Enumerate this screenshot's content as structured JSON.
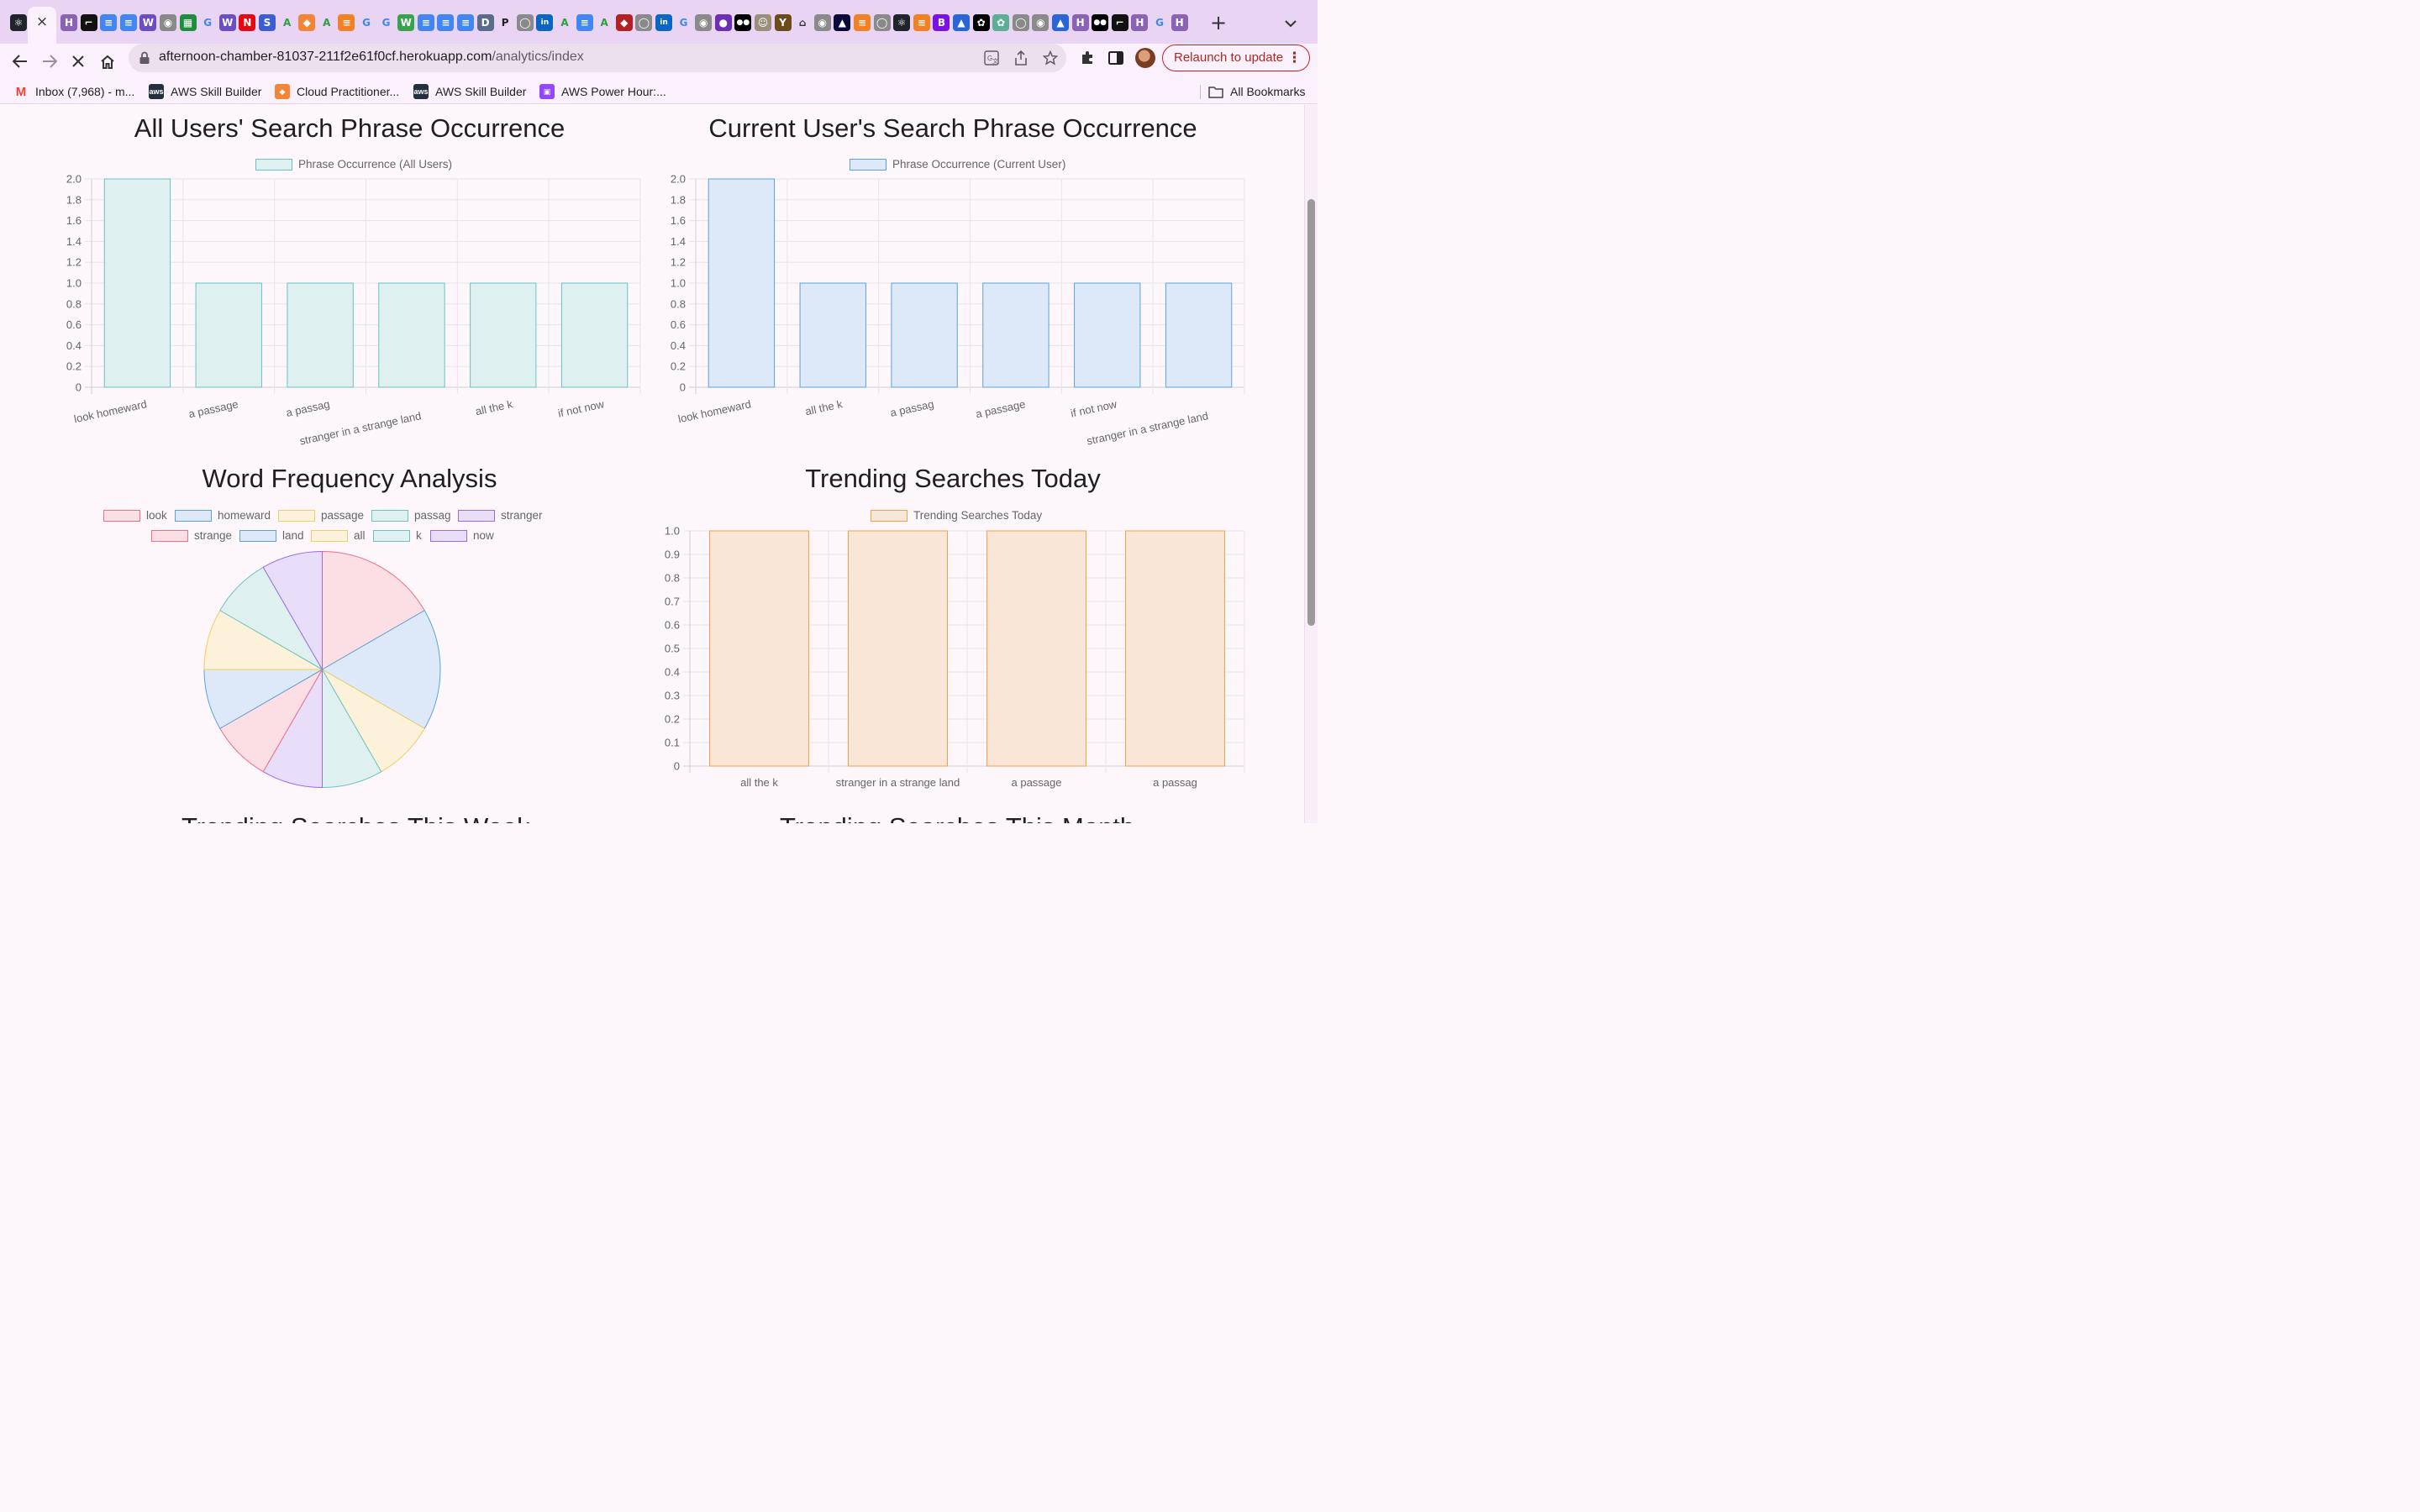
{
  "browser": {
    "tab_close_glyph": "×",
    "new_tab_glyph": "+",
    "tabs": [
      {
        "icon": "react-icon",
        "color": "#20232a",
        "glyph": "⚛"
      },
      {
        "icon": "active-tab-close",
        "color": "",
        "glyph": ""
      },
      {
        "icon": "heroku-icon",
        "color": "#8b63b5",
        "glyph": "H"
      },
      {
        "icon": "linear-icon",
        "color": "#111111",
        "glyph": "⌐"
      },
      {
        "icon": "docs-icon",
        "color": "#4285f4",
        "glyph": "≡"
      },
      {
        "icon": "docs-icon",
        "color": "#4285f4",
        "glyph": "≡"
      },
      {
        "icon": "workers-icon",
        "color": "#6b4ec6",
        "glyph": "W"
      },
      {
        "icon": "globe-icon",
        "color": "#8a8a8a",
        "glyph": "◉"
      },
      {
        "icon": "sheet-icon",
        "color": "#1e8e3e",
        "glyph": "▦"
      },
      {
        "icon": "google-icon",
        "color": "#ffffff",
        "glyph": "G"
      },
      {
        "icon": "workers-icon",
        "color": "#6b4ec6",
        "glyph": "W"
      },
      {
        "icon": "netflix-icon",
        "color": "#e50914",
        "glyph": "N"
      },
      {
        "icon": "sql-icon",
        "color": "#3b5fd0",
        "glyph": "S"
      },
      {
        "icon": "aws-green-icon",
        "color": "#ffffff",
        "glyph": "A"
      },
      {
        "icon": "cube-icon",
        "color": "#f58536",
        "glyph": "◆"
      },
      {
        "icon": "aws-green-icon",
        "color": "#ffffff",
        "glyph": "A"
      },
      {
        "icon": "stackoverflow-icon",
        "color": "#f48024",
        "glyph": "≡"
      },
      {
        "icon": "google-icon",
        "color": "#ffffff",
        "glyph": "G"
      },
      {
        "icon": "google-icon",
        "color": "#ffffff",
        "glyph": "G"
      },
      {
        "icon": "w-icon",
        "color": "#37a34a",
        "glyph": "W"
      },
      {
        "icon": "docs-icon",
        "color": "#4285f4",
        "glyph": "≡"
      },
      {
        "icon": "docs-icon",
        "color": "#4285f4",
        "glyph": "≡"
      },
      {
        "icon": "docs-icon",
        "color": "#4285f4",
        "glyph": "≡"
      },
      {
        "icon": "dev-icon",
        "color": "#5a6b8c",
        "glyph": "D"
      },
      {
        "icon": "p-icon",
        "color": "#ffffff",
        "glyph": "P"
      },
      {
        "icon": "github-icon",
        "color": "#8a8a8a",
        "glyph": "◯"
      },
      {
        "icon": "linkedin-icon",
        "color": "#0a66c2",
        "glyph": "in"
      },
      {
        "icon": "aws-green-icon",
        "color": "#ffffff",
        "glyph": "A"
      },
      {
        "icon": "docs-icon",
        "color": "#4285f4",
        "glyph": "≡"
      },
      {
        "icon": "aws-green-icon",
        "color": "#ffffff",
        "glyph": "A"
      },
      {
        "icon": "ruby-icon",
        "color": "#b52020",
        "glyph": "◆"
      },
      {
        "icon": "github-icon",
        "color": "#8a8a8a",
        "glyph": "◯"
      },
      {
        "icon": "linkedin-icon",
        "color": "#0a66c2",
        "glyph": "in"
      },
      {
        "icon": "google-icon",
        "color": "#ffffff",
        "glyph": "G"
      },
      {
        "icon": "globe-icon",
        "color": "#8a8a8a",
        "glyph": "◉"
      },
      {
        "icon": "blob-icon",
        "color": "#6a2fb6",
        "glyph": "●"
      },
      {
        "icon": "medium-icon",
        "color": "#000000",
        "glyph": "●●"
      },
      {
        "icon": "face-icon",
        "color": "#9b8e7a",
        "glyph": "☺"
      },
      {
        "icon": "ycombinator-icon",
        "color": "#6b4a1c",
        "glyph": "Y"
      },
      {
        "icon": "home-icon",
        "color": "#ffffff",
        "glyph": "⌂"
      },
      {
        "icon": "globe-icon",
        "color": "#8a8a8a",
        "glyph": "◉"
      },
      {
        "icon": "vercel-icon",
        "color": "#0b0b3a",
        "glyph": "▲"
      },
      {
        "icon": "stackoverflow-icon",
        "color": "#f48024",
        "glyph": "≡"
      },
      {
        "icon": "github-icon",
        "color": "#8a8a8a",
        "glyph": "◯"
      },
      {
        "icon": "react-icon",
        "color": "#20232a",
        "glyph": "⚛"
      },
      {
        "icon": "stackoverflow-icon",
        "color": "#f48024",
        "glyph": "≡"
      },
      {
        "icon": "bootstrap-icon",
        "color": "#7a12e6",
        "glyph": "B"
      },
      {
        "icon": "atlassian-icon",
        "color": "#2965d6",
        "glyph": "▲"
      },
      {
        "icon": "openai-icon",
        "color": "#000000",
        "glyph": "✿"
      },
      {
        "icon": "openai-icon",
        "color": "#5cae95",
        "glyph": "✿"
      },
      {
        "icon": "github-icon",
        "color": "#8a8a8a",
        "glyph": "◯"
      },
      {
        "icon": "globe-icon",
        "color": "#8a8a8a",
        "glyph": "◉"
      },
      {
        "icon": "atlassian-icon",
        "color": "#2965d6",
        "glyph": "▲"
      },
      {
        "icon": "heroku-icon",
        "color": "#8b63b5",
        "glyph": "H"
      },
      {
        "icon": "medium-icon",
        "color": "#000000",
        "glyph": "●●"
      },
      {
        "icon": "linear-icon",
        "color": "#111111",
        "glyph": "⌐"
      },
      {
        "icon": "heroku-icon",
        "color": "#8b63b5",
        "glyph": "H"
      },
      {
        "icon": "google-icon",
        "color": "#ffffff",
        "glyph": "G"
      },
      {
        "icon": "heroku-icon",
        "color": "#8b63b5",
        "glyph": "H"
      }
    ],
    "url_host": "afternoon-chamber-81037-211f2e61f0cf.herokuapp.com",
    "url_path": "/analytics/index",
    "relaunch_label": "Relaunch to update",
    "relaunch_menu": "⋮",
    "bookmarks": [
      {
        "label": "Inbox (7,968) - m...",
        "icon": "gmail-icon",
        "color": "#ffffff",
        "glyph": "M"
      },
      {
        "label": "AWS Skill Builder",
        "icon": "aws-icon",
        "color": "#232f3e",
        "glyph": "aws"
      },
      {
        "label": "Cloud Practitioner...",
        "icon": "cube-icon",
        "color": "#f58536",
        "glyph": "◆"
      },
      {
        "label": "AWS Skill Builder",
        "icon": "aws-icon",
        "color": "#232f3e",
        "glyph": "aws"
      },
      {
        "label": "AWS Power Hour:...",
        "icon": "twitch-icon",
        "color": "#9146ff",
        "glyph": "▣"
      }
    ],
    "all_bookmarks_label": "All Bookmarks"
  },
  "charts": {
    "all_users": {
      "title": "All Users' Search Phrase Occurrence",
      "legend": "Phrase Occurrence (All Users)",
      "fill": "#dff0f0",
      "stroke": "#6cc2c2"
    },
    "current_user": {
      "title": "Current User's Search Phrase Occurrence",
      "legend": "Phrase Occurrence (Current User)",
      "fill": "#dde9f8",
      "stroke": "#5ea2dc"
    },
    "word_freq": {
      "title": "Word Frequency Analysis"
    },
    "trending_today": {
      "title": "Trending Searches Today",
      "legend": "Trending Searches Today",
      "fill": "#fae6d6",
      "stroke": "#f0a04b"
    }
  },
  "peek": {
    "left": "Trending Searches This Week",
    "right": "Trending Searches This Month"
  },
  "chart_data": [
    {
      "type": "bar",
      "title": "All Users' Search Phrase Occurrence",
      "categories": [
        "look homeward",
        "a passage",
        "a passag",
        "stranger in a strange land",
        "all the k",
        "if not now"
      ],
      "series": [
        {
          "name": "Phrase Occurrence (All Users)",
          "values": [
            2,
            1,
            1,
            1,
            1,
            1
          ]
        }
      ],
      "ylim": [
        0,
        2.0
      ],
      "yticks": [
        "0",
        "0.2",
        "0.4",
        "0.6",
        "0.8",
        "1.0",
        "1.2",
        "1.4",
        "1.6",
        "1.8",
        "2.0"
      ],
      "legend": "top",
      "grid": true
    },
    {
      "type": "bar",
      "title": "Current User's Search Phrase Occurrence",
      "categories": [
        "look homeward",
        "all the k",
        "a passag",
        "a passage",
        "if not now",
        "stranger in a strange land"
      ],
      "series": [
        {
          "name": "Phrase Occurrence (Current User)",
          "values": [
            2,
            1,
            1,
            1,
            1,
            1
          ]
        }
      ],
      "ylim": [
        0,
        2.0
      ],
      "yticks": [
        "0",
        "0.2",
        "0.4",
        "0.6",
        "0.8",
        "1.0",
        "1.2",
        "1.4",
        "1.6",
        "1.8",
        "2.0"
      ],
      "legend": "top",
      "grid": true
    },
    {
      "type": "pie",
      "title": "Word Frequency Analysis",
      "labels": [
        "look",
        "homeward",
        "passage",
        "passag",
        "stranger",
        "strange",
        "land",
        "all",
        "k",
        "now"
      ],
      "values": [
        2,
        2,
        1,
        1,
        1,
        1,
        1,
        1,
        1,
        1
      ],
      "colors": [
        {
          "fill": "#fbdfe5",
          "stroke": "#ef6e86"
        },
        {
          "fill": "#dde9f8",
          "stroke": "#5ea2dc"
        },
        {
          "fill": "#fcf2da",
          "stroke": "#f4cc63"
        },
        {
          "fill": "#dff0f0",
          "stroke": "#6cc2c2"
        },
        {
          "fill": "#e8defa",
          "stroke": "#9a6be8"
        },
        {
          "fill": "#fbdfe5",
          "stroke": "#ef6e86"
        },
        {
          "fill": "#dde9f8",
          "stroke": "#5ea2dc"
        },
        {
          "fill": "#fcf2da",
          "stroke": "#f4cc63"
        },
        {
          "fill": "#dff0f0",
          "stroke": "#6cc2c2"
        },
        {
          "fill": "#e8defa",
          "stroke": "#9a6be8"
        }
      ],
      "legend": "top"
    },
    {
      "type": "bar",
      "title": "Trending Searches Today",
      "categories": [
        "all the k",
        "stranger in a strange land",
        "a passage",
        "a passag"
      ],
      "series": [
        {
          "name": "Trending Searches Today",
          "values": [
            1,
            1,
            1,
            1
          ]
        }
      ],
      "ylim": [
        0,
        1.0
      ],
      "yticks": [
        "0",
        "0.1",
        "0.2",
        "0.3",
        "0.4",
        "0.5",
        "0.6",
        "0.7",
        "0.8",
        "0.9",
        "1.0"
      ],
      "legend": "top",
      "grid": true
    }
  ]
}
